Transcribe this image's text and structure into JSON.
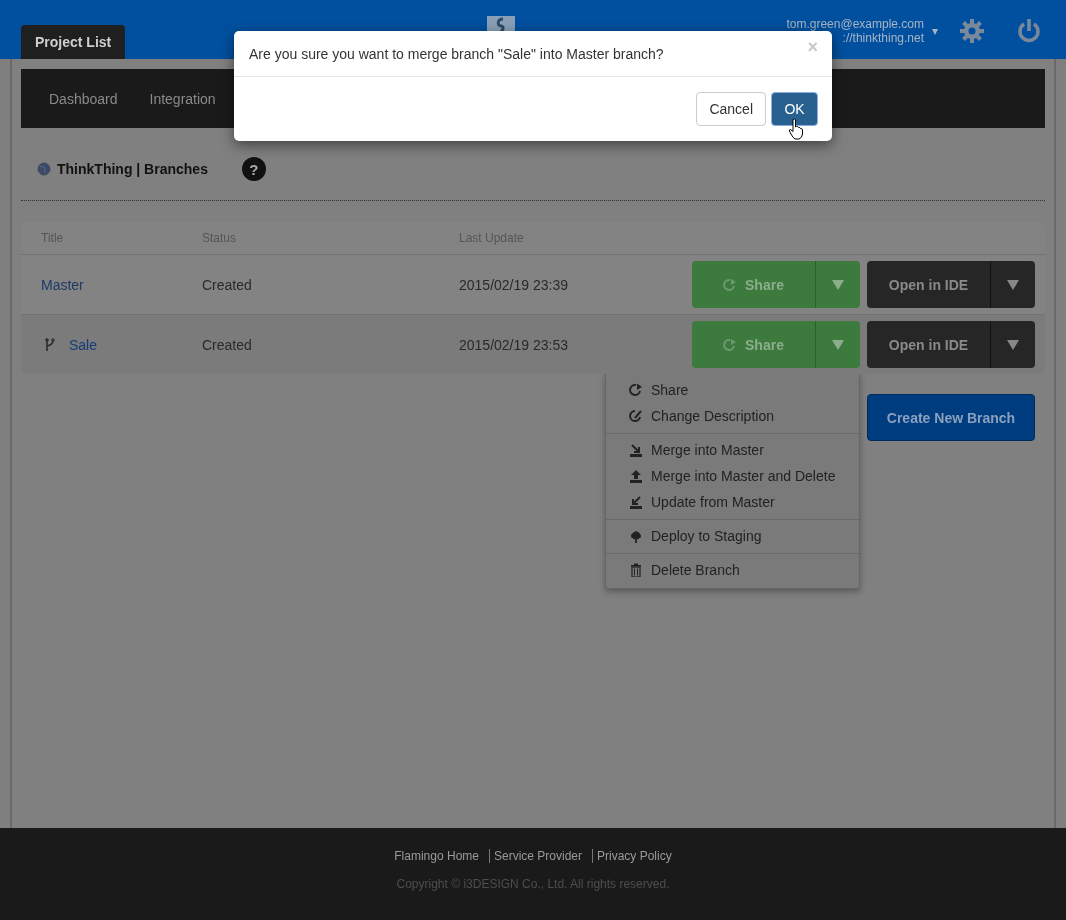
{
  "header": {
    "user_email": "tom.green@example.com",
    "user_site": "://thinkthing.net",
    "user_caret": "▾"
  },
  "tabs": [
    {
      "label": "Project List",
      "selected": true
    }
  ],
  "nav": [
    {
      "label": "Dashboard",
      "selected": false
    },
    {
      "label": "Integration",
      "selected": false
    }
  ],
  "page_title": "ThinkThing | Branches",
  "help": "?",
  "table": {
    "columns": [
      "Title",
      "Status",
      "Last Update"
    ],
    "rows": [
      {
        "kind": "master",
        "title": "Master",
        "status": "Created",
        "last_update": "2015/02/19 23:39",
        "share": "Share",
        "open": "Open in IDE"
      },
      {
        "kind": "branch",
        "title": "Sale",
        "status": "Created",
        "last_update": "2015/02/19 23:53",
        "share": "Share",
        "open": "Open in IDE"
      }
    ]
  },
  "menu": [
    {
      "items": [
        {
          "kind": "share",
          "label": "Share"
        },
        {
          "kind": "edit",
          "label": "Change Description"
        }
      ]
    },
    {
      "items": [
        {
          "kind": "merge",
          "label": "Merge into Master"
        },
        {
          "kind": "upload",
          "label": "Merge into Master and Delete"
        },
        {
          "kind": "update",
          "label": "Update from Master"
        }
      ]
    },
    {
      "items": [
        {
          "kind": "cloud",
          "label": "Deploy to Staging"
        }
      ]
    },
    {
      "items": [
        {
          "kind": "trash",
          "label": "Delete Branch"
        }
      ]
    }
  ],
  "create_button": "Create New Branch",
  "footer": {
    "links": [
      "Flamingo Home",
      "Service Provider",
      "Privacy Policy"
    ],
    "copyright": "Copyright © i3DESIGN Co., Ltd. All rights reserved."
  },
  "dialog": {
    "message": "Are you sure you want to merge branch \"Sale\" into Master branch?",
    "close": "×",
    "cancel": "Cancel",
    "ok": "OK"
  }
}
